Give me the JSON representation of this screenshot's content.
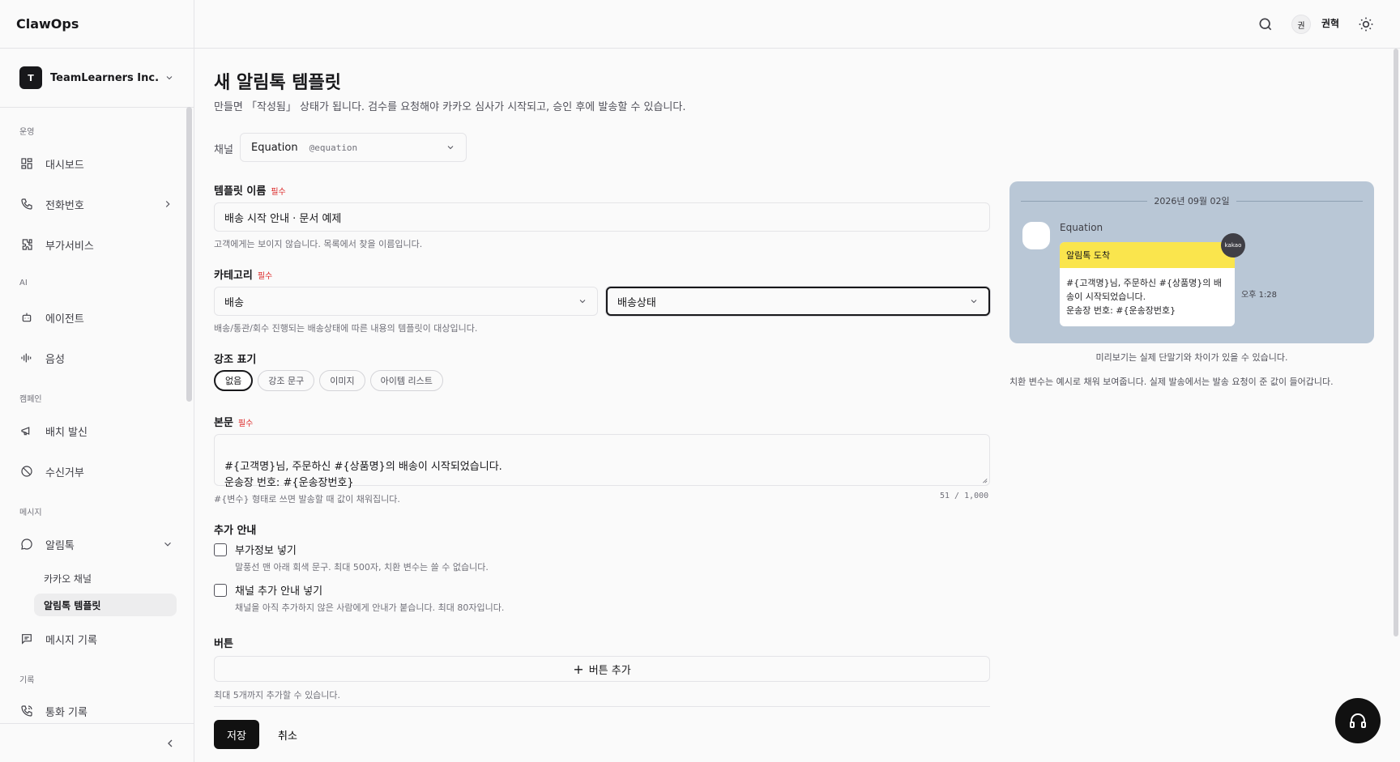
{
  "app": {
    "brand": "ClawOps"
  },
  "org": {
    "initial": "T",
    "name": "TeamLearners Inc."
  },
  "nav": {
    "sections": [
      {
        "label": "운영"
      },
      {
        "label": "AI"
      },
      {
        "label": "캠페인"
      },
      {
        "label": "메시지"
      },
      {
        "label": "기록"
      }
    ],
    "items": [
      {
        "label": "대시보드",
        "icon": "dashboard-icon"
      },
      {
        "label": "전화번호",
        "icon": "phone-icon"
      },
      {
        "label": "부가서비스",
        "icon": "puzzle-icon"
      },
      {
        "label": "에이전트",
        "icon": "bot-icon"
      },
      {
        "label": "음성",
        "icon": "audio-wave-icon"
      },
      {
        "label": "배치 발신",
        "icon": "megaphone-icon"
      },
      {
        "label": "수신거부",
        "icon": "ban-icon"
      },
      {
        "label": "알림톡",
        "icon": "chat-bubble-icon"
      },
      {
        "label": "메시지 기록",
        "icon": "message-square-icon"
      },
      {
        "label": "통화 기록",
        "icon": "phone-call-icon"
      }
    ],
    "sub_items": [
      {
        "label": "카카오 채널"
      },
      {
        "label": "알림톡 템플릿"
      }
    ]
  },
  "header": {
    "user_initial": "권",
    "user_name": "권혁"
  },
  "page": {
    "title": "새 알림톡 템플릿",
    "description": "만들면 「작성됨」 상태가 됩니다. 검수를 요청해야 카카오 심사가 시작되고, 승인 후에 발송할 수 있습니다."
  },
  "channel": {
    "label": "채널",
    "name": "Equation",
    "handle": "@equation"
  },
  "form": {
    "required": "필수",
    "name": {
      "label": "템플릿 이름",
      "value": "배송 시작 안내 · 문서 예제",
      "help": "고객에게는 보이지 않습니다. 목록에서 찾을 이름입니다."
    },
    "category": {
      "label": "카테고리",
      "primary": "배송",
      "secondary": "배송상태",
      "help": "배송/통관/회수 진행되는 배송상태에 따른 내용의 템플릿이 대상입니다."
    },
    "emphasis": {
      "label": "강조 표기",
      "options": [
        "없음",
        "강조 문구",
        "이미지",
        "아이템 리스트"
      ]
    },
    "body": {
      "label": "본문",
      "value": "#{고객명}님, 주문하신 #{상품명}의 배송이 시작되었습니다.\n운송장 번호: #{운송장번호}",
      "help": "#{변수} 형태로 쓰면 발송할 때 값이 채워집니다.",
      "counter": "51 / 1,000"
    },
    "extra": {
      "label": "추가 안내",
      "options": [
        {
          "label": "부가정보 넣기",
          "help": "말풍선 맨 아래 회색 문구. 최대 500자, 치환 변수는 쓸 수 없습니다."
        },
        {
          "label": "채널 추가 안내 넣기",
          "help": "채널을 아직 추가하지 않은 사람에게 안내가 붙습니다. 최대 80자입니다."
        }
      ]
    },
    "buttons": {
      "label": "버튼",
      "add_label": "버튼 추가",
      "help": "최대 5개까지 추가할 수 있습니다."
    },
    "save_label": "저장",
    "cancel_label": "취소"
  },
  "preview": {
    "date": "2026년 09월 02일",
    "sender": "Equation",
    "header": "알림톡 도착",
    "body": "#{고객명}님, 주문하신 #{상품명}의 배\n송이 시작되었습니다.\n운송장 번호: #{운송장번호}",
    "badge": "kakao",
    "time": "오후 1:28",
    "note1": "미리보기는 실제 단말기와 차이가 있을 수 있습니다.",
    "note2": "치환 변수는 예시로 채워 보여줍니다. 실제 발송에서는 발송 요청이 준 값이 들어갑니다.",
    "bg_color": "#b9c7d6",
    "header_color": "#fae54d"
  }
}
